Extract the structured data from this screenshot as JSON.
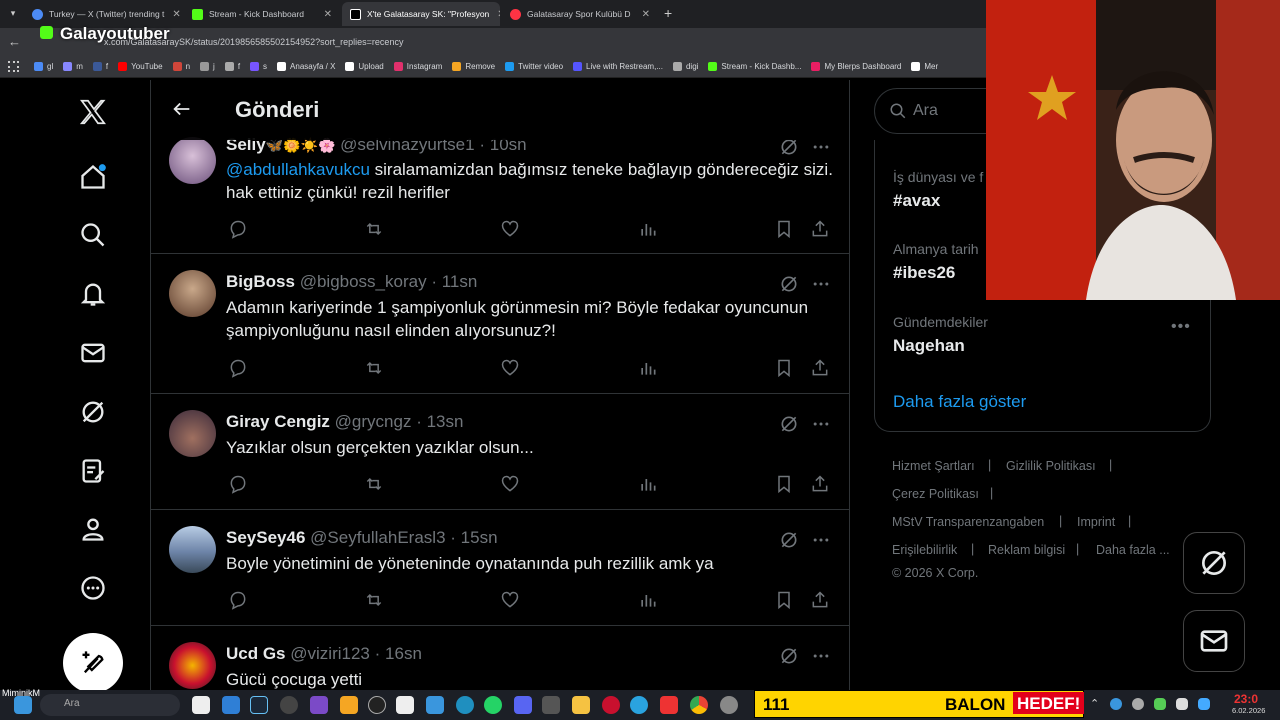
{
  "browser": {
    "tabs": [
      {
        "label": "Turkey — X (Twitter) trending t",
        "color": "#4c8bf5"
      },
      {
        "label": "Stream - Kick Dashboard",
        "color": "#53fc18"
      },
      {
        "label": "X'te Galatasaray SK: \"Profesyon",
        "color": "#ffffff"
      },
      {
        "label": "Galatasaray Spor Kulübü D",
        "color": "#ff3344"
      }
    ],
    "url": "x.com/GalatasaraySK/status/2019856585502154952?sort_replies=recency",
    "overlay_name": "Galayoutuber",
    "bookmarks": [
      {
        "label": "gl",
        "color": "#4c8bf5"
      },
      {
        "label": "m",
        "color": "#8888ff"
      },
      {
        "label": "f",
        "color": "#3b5998"
      },
      {
        "label": "YouTube",
        "color": "#ff0000"
      },
      {
        "label": "n",
        "color": "#d0463a"
      },
      {
        "label": "j",
        "color": "#999999"
      },
      {
        "label": "f",
        "color": "#aaaaaa"
      },
      {
        "label": "s",
        "color": "#7755ff"
      },
      {
        "label": "Anasayfa / X",
        "color": "#ffffff"
      },
      {
        "label": "Upload",
        "color": "#ffffff"
      },
      {
        "label": "Instagram",
        "color": "#e1306c"
      },
      {
        "label": "Remove",
        "color": "#f5a623"
      },
      {
        "label": "Twitter video",
        "color": "#1d9bf0"
      },
      {
        "label": "Live with Restream,...",
        "color": "#5555ff"
      },
      {
        "label": "digi",
        "color": "#aaaaaa"
      },
      {
        "label": "Stream - Kick Dashb...",
        "color": "#53fc18"
      },
      {
        "label": "My Blerps Dashboard",
        "color": "#e91e63"
      },
      {
        "label": "Mer",
        "color": "#ffffff"
      }
    ]
  },
  "header": {
    "title": "Gönderi"
  },
  "tweets": [
    {
      "name": "Seliy",
      "emoji": "🦋🌼☀️🌸",
      "handle": "@selvinazyurtse1",
      "time": "10sn",
      "mention": "@abdullahkavukcu",
      "text": " siralamamizdan bağımsız teneke bağlayıp göndereceğiz sizi. hak ettiniz çünkü! rezil herifler",
      "avatar_color": "#9a7fa6"
    },
    {
      "name": "BigBoss",
      "handle": "@bigboss_koray",
      "time": "11sn",
      "text": "Adamın kariyerinde 1 şampiyonluk görünmesin mi? Böyle fedakar oyuncunun şampiyonluğunu nasıl elinden alıyorsunuz?!",
      "avatar_color": "#7a5a45"
    },
    {
      "name": "Giray Cengiz",
      "handle": "@grycngz",
      "time": "13sn",
      "text": "Yazıklar olsun gerçekten yazıklar olsun...",
      "avatar_color": "#6a4a3a"
    },
    {
      "name": "SeySey46",
      "handle": "@SeyfullahErasl3",
      "time": "15sn",
      "text": "Boyle yönetimini de yöneteninde oynatanında puh rezillik amk ya",
      "avatar_color": "#8aa0c0"
    },
    {
      "name": "Ucd Gs",
      "handle": "@viziri123",
      "time": "16sn",
      "text": "Gücü çocuga yetti",
      "avatar_color": "#c8102e"
    }
  ],
  "search": {
    "placeholder": "Ara"
  },
  "trends": [
    {
      "category": "İş dünyası ve f",
      "value": "#avax"
    },
    {
      "category": "Almanya tarih",
      "value": "#ibes26"
    },
    {
      "category": "Gündemdekiler",
      "value": "Nagehan"
    }
  ],
  "show_more": "Daha fazla göster",
  "footer": {
    "links": [
      "Hizmet Şartları",
      "Gizlilik Politikası",
      "Çerez Politikası",
      "MStV Transparenzangaben",
      "Imprint",
      "Erişilebilirlik",
      "Reklam bilgisi",
      "Daha fazla ..."
    ],
    "copyright": "© 2026 X Corp."
  },
  "taskbar": {
    "user": "MiminikM",
    "search": "Ara",
    "ticker_count": "111",
    "ticker_text1": "BALON",
    "ticker_text2": "HEDEF!",
    "time": "23:0",
    "date": "6.02.2026"
  },
  "colors": {
    "accent": "#1d9bf0",
    "ticker_bg": "#ffd400",
    "ticker_red": "#e3001b"
  }
}
